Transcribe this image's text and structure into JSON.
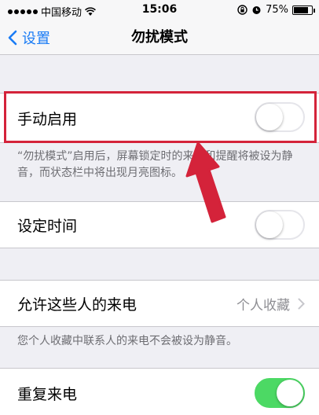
{
  "status_bar": {
    "carrier": "中国移动",
    "time": "15:06",
    "battery": "75%",
    "battery_level": 0.75,
    "icons": [
      "signal-dots-icon",
      "wifi-icon",
      "lock-rotation-icon",
      "alarm-icon",
      "battery-icon"
    ]
  },
  "nav": {
    "back_label": "设置",
    "title": "勿扰模式"
  },
  "manual": {
    "label": "手动启用",
    "toggle_on": false
  },
  "manual_footnote": "“勿扰模式”启用后，屏幕锁定时的来电和提醒将被设为静音，而状态栏中将出现月亮图标。",
  "scheduled": {
    "label": "设定时间",
    "toggle_on": false
  },
  "allow_calls": {
    "label": "允许这些人的来电",
    "value": "个人收藏"
  },
  "allow_footnote": "您个人收藏中联系人的来电不会被设为静音。",
  "repeat": {
    "label": "重复来电",
    "toggle_on": true
  },
  "colors": {
    "accent": "#1a7cf5",
    "highlight": "#d4233a",
    "toggle_on": "#4cd964",
    "background": "#efeff4"
  }
}
